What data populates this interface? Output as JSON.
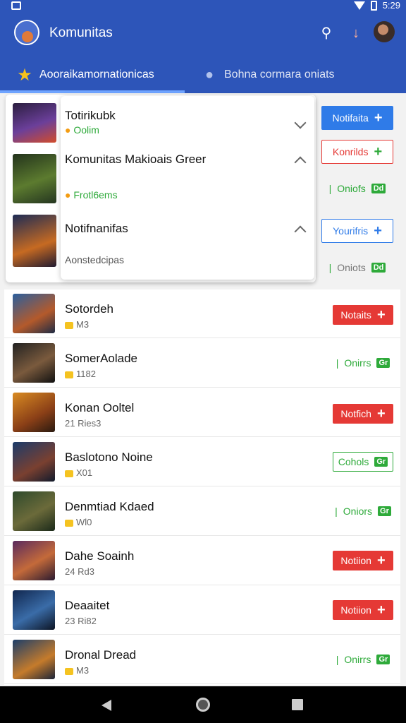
{
  "status_bar": {
    "time": "5:29"
  },
  "app_bar": {
    "title": "Komunitas"
  },
  "tabs": [
    {
      "label": "Aooraikamornationicas"
    },
    {
      "label": "Bohna cormara oniats"
    }
  ],
  "dropdown": {
    "items": [
      {
        "label": "Totirikubk",
        "sub": "Oolim"
      },
      {
        "label": "Komunitas Makioais Greer",
        "sub": "Frotl6ems"
      },
      {
        "label": "Notifnanifas",
        "sub": "Aonstedcipas"
      }
    ]
  },
  "side_buttons": [
    {
      "label": "Notifaita"
    },
    {
      "label": "Konrilds"
    },
    {
      "label": "Oniofs",
      "badge": "Dd"
    },
    {
      "label": "Yourifris"
    },
    {
      "label": "Oniots",
      "badge": "Dd"
    }
  ],
  "list": [
    {
      "title": "Sotordeh",
      "sub": "M3",
      "button": "Notaits"
    },
    {
      "title": "SomerAolade",
      "sub": "1182",
      "button": "Onirrs",
      "badge": "Gr"
    },
    {
      "title": "Konan Ooltel",
      "sub": "21 Ries3",
      "button": "Notfich"
    },
    {
      "title": "Baslotono Noine",
      "sub": "X01",
      "button": "Cohols",
      "badge": "Gr"
    },
    {
      "title": "Denmtiad Kdaed",
      "sub": "Wl0",
      "button": "Oniors",
      "badge": "Gr"
    },
    {
      "title": "Dahe Soainh",
      "sub": "24 Rd3",
      "button": "Notiion"
    },
    {
      "title": "Deaaitet",
      "sub": "23 Ri82",
      "button": "Notiion"
    },
    {
      "title": "Dronal Dread",
      "sub": "M3",
      "button": "Onirrs",
      "badge": "Gr"
    }
  ],
  "colors": {
    "primary": "#2d55b9",
    "red": "#e53935",
    "green": "#2eaa3a",
    "blue": "#2f7be8"
  }
}
